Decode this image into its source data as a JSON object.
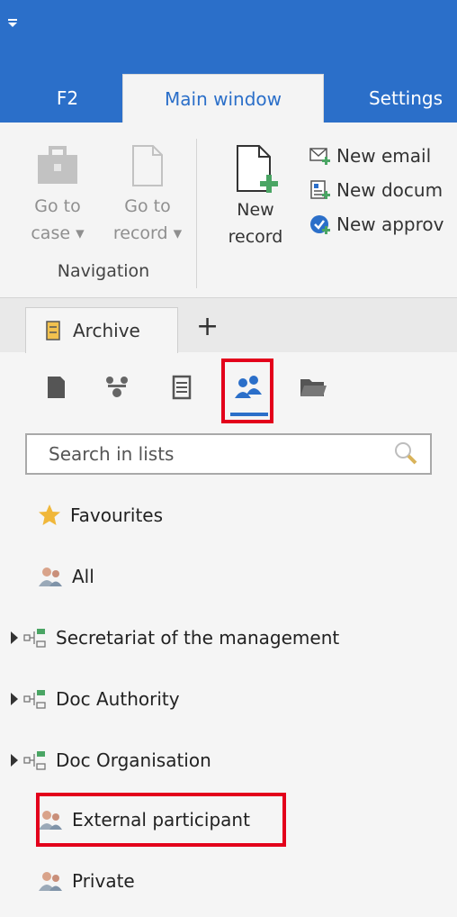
{
  "ribbon_tabs": [
    "F2",
    "Main window",
    "Settings"
  ],
  "navigation": {
    "go_to_case": {
      "line1": "Go to",
      "line2": "case ▾"
    },
    "go_to_record": {
      "line1": "Go to",
      "line2": "record ▾"
    },
    "group_label": "Navigation"
  },
  "new_record": {
    "line1": "New",
    "line2": "record"
  },
  "small_actions": [
    "New email",
    "New docum",
    "New approv"
  ],
  "doc_tab": {
    "label": "Archive",
    "add": "+"
  },
  "search": {
    "placeholder": "Search in lists"
  },
  "list_items": [
    "Favourites",
    "All",
    "Secretariat of the management",
    "Doc Authority",
    "Doc Organisation",
    "External participant",
    "Private"
  ],
  "colors": {
    "accent": "#2b6fc9",
    "highlight": "#e3001b"
  }
}
